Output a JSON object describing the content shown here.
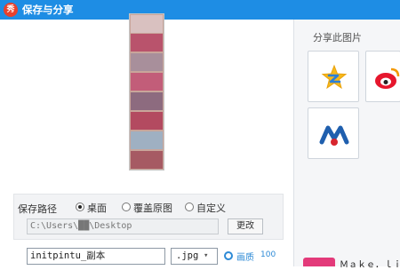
{
  "window": {
    "title": "保存与分享",
    "app_icon_glyph": "秀"
  },
  "save_path": {
    "label": "保存路径",
    "options": [
      "桌面",
      "覆盖原图",
      "自定义"
    ],
    "selected": "桌面",
    "path_value": "C:\\Users\\██\\Desktop",
    "change_button": "更改"
  },
  "file": {
    "name": "initpintu_副本",
    "extension": ".jpg",
    "quality_label": "画质",
    "quality_value": "100"
  },
  "share": {
    "title": "分享此图片",
    "targets": [
      "qzone-icon",
      "weibo-icon",
      "renren-icon"
    ]
  },
  "ad": {
    "text": "Ｍａｋｅ．ｌｉｆｅ"
  },
  "colors": {
    "titlebar": "#1e8de4",
    "accent": "#2d8ad6"
  }
}
